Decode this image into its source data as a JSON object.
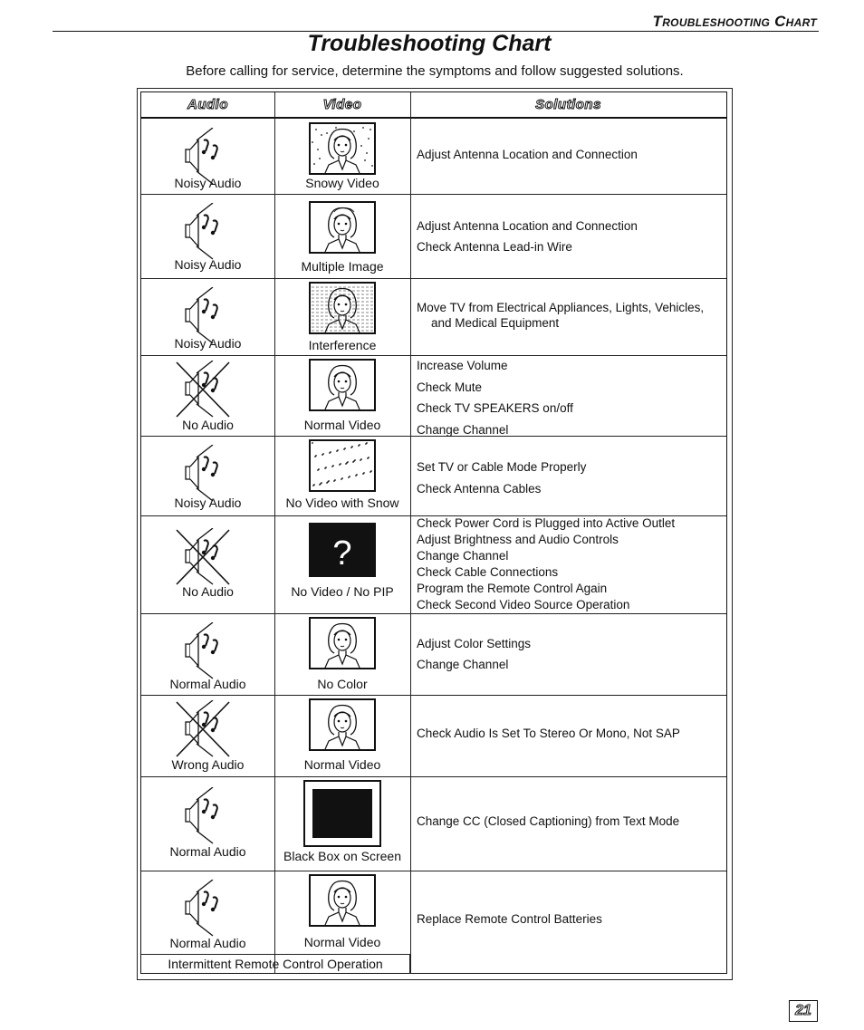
{
  "running_head": "Troubleshooting Chart",
  "title": "Troubleshooting Chart",
  "subtitle": "Before calling for service, determine the symptoms and follow suggested solutions.",
  "headers": {
    "audio": "Audio",
    "video": "Video",
    "solutions": "Solutions"
  },
  "rows": [
    {
      "audio": "Noisy Audio",
      "audio_icon": "speaker-notes-icon",
      "video": "Snowy Video",
      "video_icon": "tv-snowy-face-icon",
      "solutions": [
        "Adjust Antenna Location and Connection"
      ]
    },
    {
      "audio": "Noisy Audio",
      "audio_icon": "speaker-notes-icon",
      "video": "Multiple Image",
      "video_icon": "tv-multiple-image-icon",
      "solutions": [
        "Adjust Antenna Location and Connection",
        "Check Antenna Lead-in Wire"
      ]
    },
    {
      "audio": "Noisy Audio",
      "audio_icon": "speaker-notes-icon",
      "video": "Interference",
      "video_icon": "tv-interference-icon",
      "solutions": [
        "Move TV from Electrical Appliances, Lights, Vehicles,",
        "and Medical Equipment"
      ]
    },
    {
      "audio": "No Audio",
      "audio_icon": "speaker-crossed-icon",
      "video": "Normal Video",
      "video_icon": "tv-face-icon",
      "solutions": [
        "Increase Volume",
        "Check Mute",
        "Check TV SPEAKERS on/off",
        "Change Channel"
      ]
    },
    {
      "audio": "Noisy Audio",
      "audio_icon": "speaker-notes-icon",
      "video": "No Video with Snow",
      "video_icon": "tv-snow-only-icon",
      "solutions": [
        "Set TV or Cable Mode Properly",
        "Check Antenna Cables"
      ]
    },
    {
      "audio": "No Audio",
      "audio_icon": "speaker-crossed-icon",
      "video": "No Video / No PIP",
      "video_icon": "tv-question-icon",
      "video_glyph": "?",
      "solutions": [
        "Check Power Cord is Plugged into Active Outlet",
        "Adjust Brightness and Audio Controls",
        "Change Channel",
        "Check Cable Connections",
        "Program the Remote Control Again",
        "Check Second Video Source Operation"
      ]
    },
    {
      "audio": "Normal Audio",
      "audio_icon": "speaker-notes-icon",
      "video": "No Color",
      "video_icon": "tv-face-icon",
      "solutions": [
        "Adjust Color Settings",
        "Change Channel"
      ]
    },
    {
      "audio": "Wrong Audio",
      "audio_icon": "speaker-crossed-icon",
      "video": "Normal Video",
      "video_icon": "tv-face-icon",
      "solutions": [
        "Check Audio Is Set To Stereo Or Mono, Not SAP"
      ]
    },
    {
      "audio": "Normal Audio",
      "audio_icon": "speaker-notes-icon",
      "video": "Black Box on Screen",
      "video_icon": "tv-black-box-icon",
      "solutions": [
        "Change CC (Closed Captioning) from Text Mode"
      ]
    },
    {
      "audio": "Normal Audio",
      "audio_icon": "speaker-notes-icon",
      "video": "Normal Video",
      "video_icon": "tv-face-icon",
      "symptom_note": "Intermittent Remote Control Operation",
      "solutions": [
        "Replace Remote Control Batteries"
      ]
    }
  ],
  "page_number": "21"
}
